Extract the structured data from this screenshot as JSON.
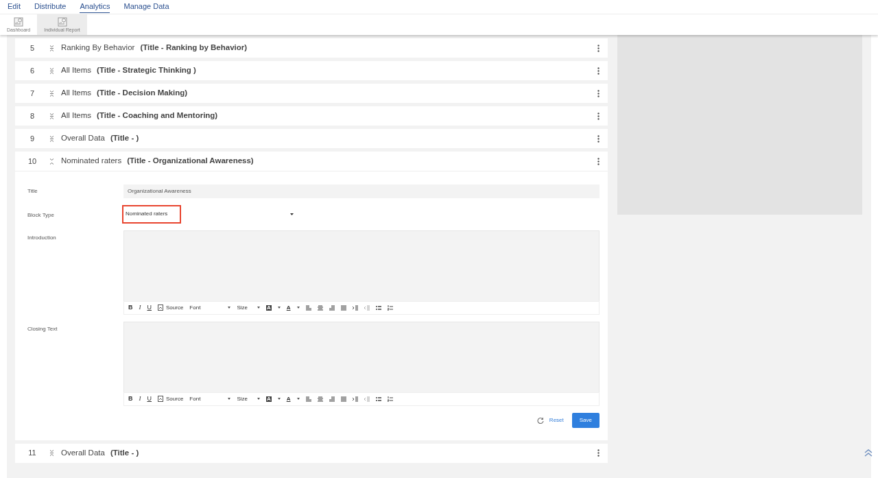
{
  "menu": [
    {
      "label": "Edit",
      "selected": false
    },
    {
      "label": "Distribute",
      "selected": false
    },
    {
      "label": "Analytics",
      "selected": true
    },
    {
      "label": "Manage Data",
      "selected": false
    }
  ],
  "ribbon": [
    {
      "label": "Dashboard",
      "selected": false
    },
    {
      "label": "Individual Report",
      "selected": true
    }
  ],
  "blocks": [
    {
      "number": "5",
      "type": "Ranking By Behavior",
      "title": "(Title - Ranking by Behavior)",
      "expanded": false
    },
    {
      "number": "6",
      "type": "All Items",
      "title": "(Title - Strategic Thinking )",
      "expanded": false
    },
    {
      "number": "7",
      "type": "All Items",
      "title": "(Title - Decision Making)",
      "expanded": false
    },
    {
      "number": "8",
      "type": "All Items",
      "title": "(Title - Coaching and Mentoring)",
      "expanded": false
    },
    {
      "number": "9",
      "type": "Overall Data",
      "title": "(Title - )",
      "expanded": false
    },
    {
      "number": "10",
      "type": "Nominated raters",
      "title": "(Title - Organizational Awareness)",
      "expanded": true,
      "details": {
        "title_label": "Title",
        "title_value": "Organizational Awareness",
        "block_type_label": "Block Type",
        "block_type_value": "Nominated raters",
        "block_type_highlighted": true,
        "editors": [
          {
            "label": "Introduction",
            "toolbar": {
              "bold": "B",
              "italic": "I",
              "underline": "U",
              "source": "Source",
              "font": "Font",
              "size": "Size",
              "bg_color": "A",
              "text_color": "A"
            }
          },
          {
            "label": "Closing Text",
            "toolbar": {
              "bold": "B",
              "italic": "I",
              "underline": "U",
              "source": "Source",
              "font": "Font",
              "size": "Size",
              "bg_color": "A",
              "text_color": "A"
            }
          }
        ],
        "reset": "Reset",
        "save": "Save"
      }
    },
    {
      "number": "11",
      "type": "Overall Data",
      "title": "(Title - )",
      "expanded": false
    }
  ]
}
